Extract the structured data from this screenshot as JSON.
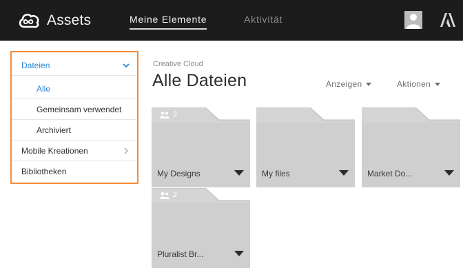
{
  "header": {
    "app_title": "Assets",
    "tabs": [
      {
        "label": "Meine Elemente",
        "active": true
      },
      {
        "label": "Aktivität",
        "active": false
      }
    ],
    "logo_icon": "creative-cloud-icon",
    "brand_logo": "adobe-logo-icon",
    "avatar_icon": "user-avatar-icon"
  },
  "sidebar": {
    "items": [
      {
        "label": "Dateien",
        "expanded": true,
        "chevron": "chevron-down-icon"
      },
      {
        "label": "Alle",
        "selected": true
      },
      {
        "label": "Gemeinsam verwendet"
      },
      {
        "label": "Archiviert"
      },
      {
        "label": "Mobile Kreationen",
        "chevron": "chevron-right-icon"
      },
      {
        "label": "Bibliotheken"
      }
    ]
  },
  "main": {
    "breadcrumb": "Creative Cloud",
    "title": "Alle Dateien",
    "actions": [
      {
        "label": "Anzeigen"
      },
      {
        "label": "Aktionen"
      }
    ],
    "folders": [
      {
        "name": "My Designs",
        "shared_count": "2",
        "shared": true
      },
      {
        "name": "My files",
        "shared": false
      },
      {
        "name": "Market Do...",
        "shared": false
      },
      {
        "name": "Pluralist Br...",
        "shared_count": "2",
        "shared": true
      }
    ]
  },
  "colors": {
    "topbar": "#1c1c1c",
    "accent_blue": "#2a86d6",
    "highlight_orange": "#f28b3c",
    "folder_gray": "#cfcfcf"
  }
}
